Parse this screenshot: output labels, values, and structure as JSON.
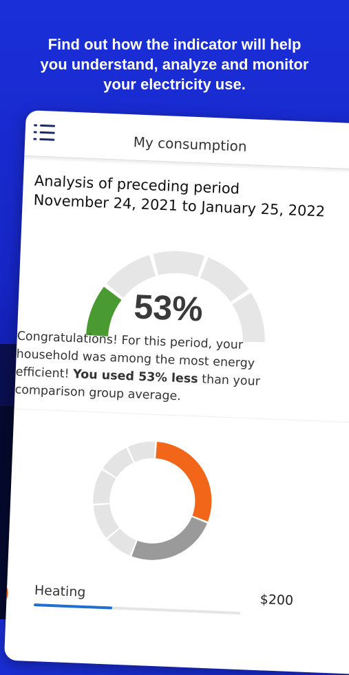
{
  "headline": {
    "line1": "Find out how the indicator will help",
    "line2": "you understand, analyze and monitor",
    "line3": "your electricity use."
  },
  "app": {
    "title": "My consumption",
    "menu_icon": "hamburger-list-icon"
  },
  "analysis": {
    "line1": "Analysis of preceding period",
    "line2": "November 24, 2021 to January 25, 2022"
  },
  "gauge": {
    "value_label": "53%",
    "percent": 53,
    "filled_segments": 1,
    "total_segments": 5,
    "colors": {
      "filled": "#4a9a32",
      "empty": "#e6e6e6"
    }
  },
  "message": {
    "part1": "Congratulations! For this period, your household was among the most energy efficient! ",
    "bold": "You used 53% less",
    "part2": " than your comparison group average."
  },
  "donut": {
    "segments": [
      {
        "fraction": 0.3,
        "color": "#f2661a"
      },
      {
        "fraction": 0.25,
        "color": "#9a9a9a"
      },
      {
        "fraction": 0.08,
        "color": "#e4e4e4"
      },
      {
        "fraction": 0.1,
        "color": "#e4e4e4"
      },
      {
        "fraction": 0.1,
        "color": "#e4e4e4"
      },
      {
        "fraction": 0.09,
        "color": "#e4e4e4"
      },
      {
        "fraction": 0.08,
        "color": "#e4e4e4"
      }
    ]
  },
  "breakdown": {
    "heating_label": "Heating",
    "heating_value": "$200",
    "heating_icon": "heat-waves-icon",
    "heating_bar_fraction": 0.38,
    "colors": {
      "icon_bg": "#f2661a",
      "bar": "#1f6fd1"
    }
  }
}
